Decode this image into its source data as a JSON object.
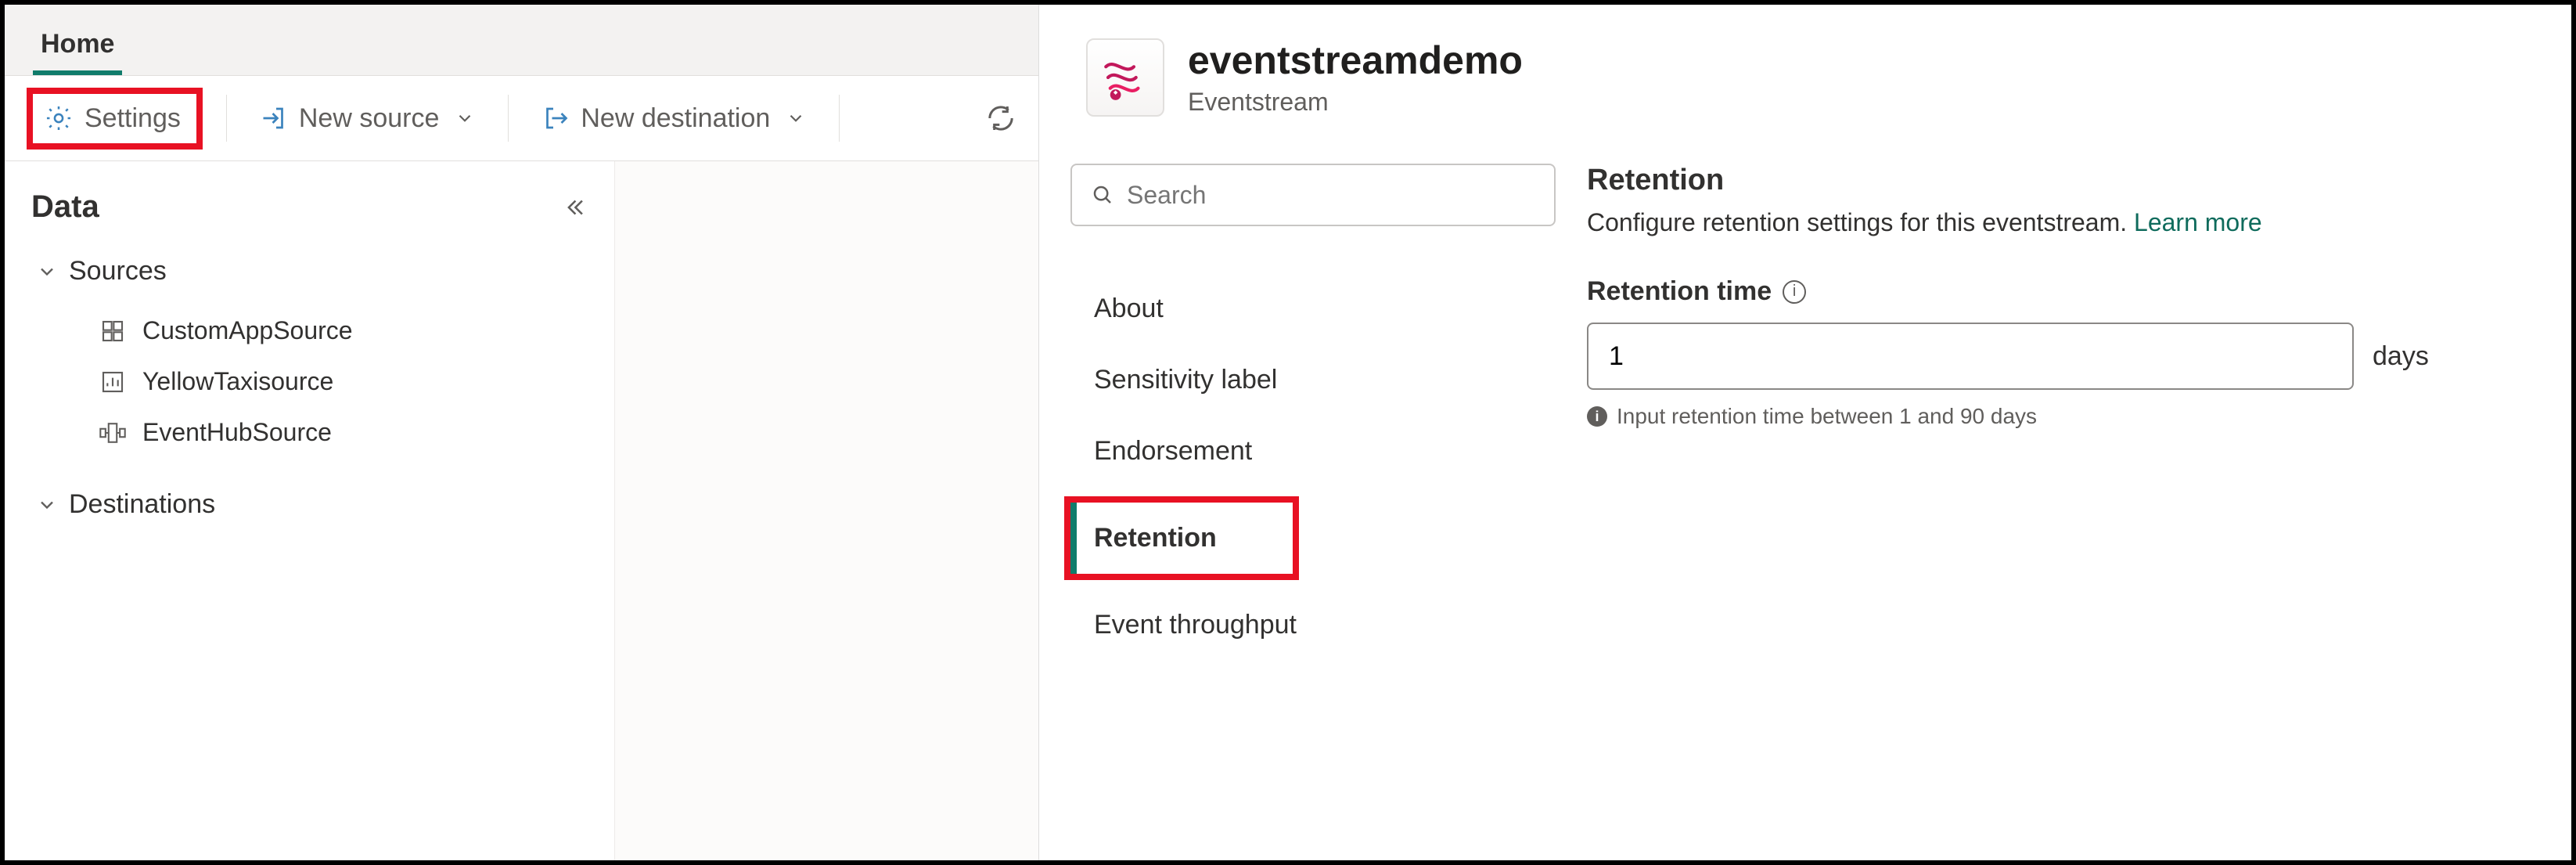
{
  "tabs": {
    "home_label": "Home"
  },
  "toolbar": {
    "settings_label": "Settings",
    "new_source_label": "New source",
    "new_destination_label": "New destination"
  },
  "data_panel": {
    "title": "Data",
    "groups": {
      "sources_label": "Sources",
      "destinations_label": "Destinations"
    },
    "sources": [
      {
        "name": "CustomAppSource",
        "icon": "grid-icon"
      },
      {
        "name": "YellowTaxisource",
        "icon": "chart-icon"
      },
      {
        "name": "EventHubSource",
        "icon": "hub-icon"
      }
    ]
  },
  "flyout": {
    "title": "eventstreamdemo",
    "subtitle": "Eventstream",
    "search_placeholder": "Search",
    "nav": {
      "about": "About",
      "sensitivity": "Sensitivity label",
      "endorsement": "Endorsement",
      "retention": "Retention",
      "throughput": "Event throughput"
    },
    "retention": {
      "heading": "Retention",
      "description": "Configure retention settings for this eventstream. ",
      "learn_more": "Learn more",
      "field_label": "Retention time",
      "value": "1",
      "unit": "days",
      "hint": "Input retention time between 1 and 90 days"
    }
  },
  "colors": {
    "accent": "#107c6b",
    "highlight": "#e81123"
  }
}
